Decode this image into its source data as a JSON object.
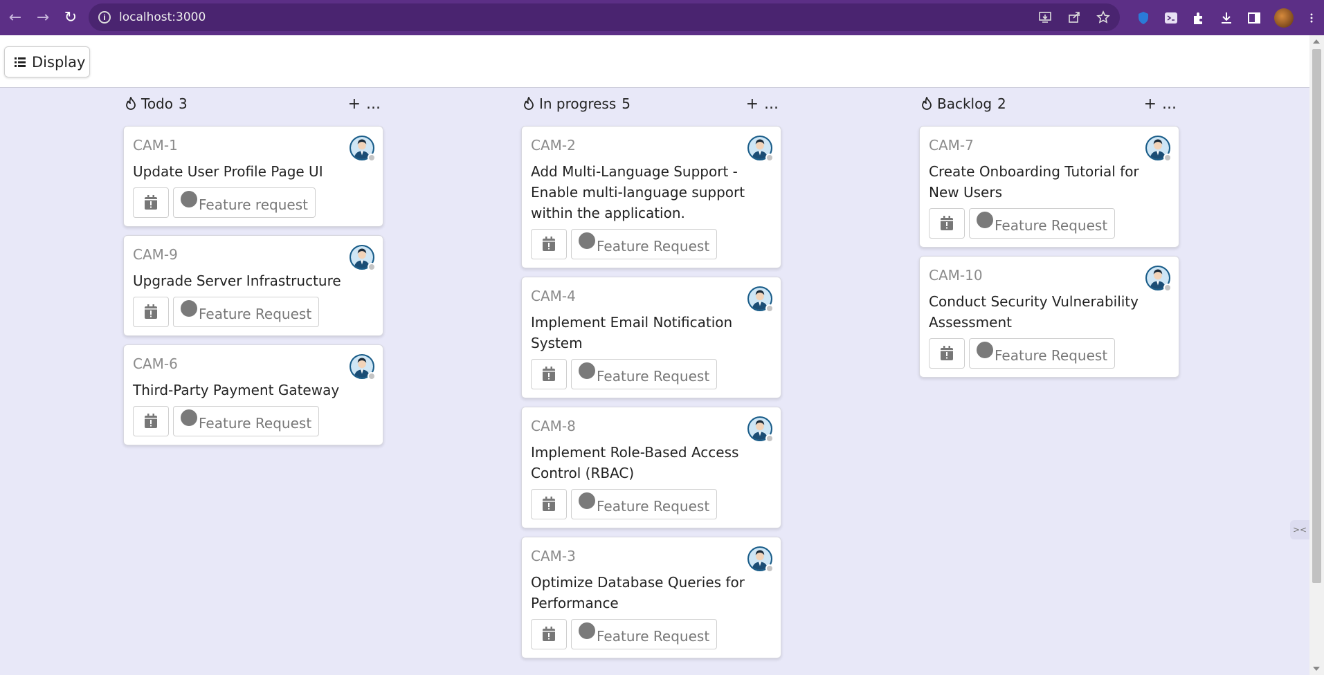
{
  "browser": {
    "url": "localhost:3000"
  },
  "toolbar": {
    "display_label": "Display"
  },
  "columns": [
    {
      "title": "Todo",
      "count": "3",
      "add_label": "+",
      "more_label": "...",
      "cards": [
        {
          "id": "CAM-1",
          "title": "Update User Profile Page UI",
          "tag": "Feature request"
        },
        {
          "id": "CAM-9",
          "title": "Upgrade Server Infrastructure",
          "tag": "Feature Request"
        },
        {
          "id": "CAM-6",
          "title": "Third-Party Payment Gateway",
          "tag": "Feature Request"
        }
      ]
    },
    {
      "title": "In progress",
      "count": "5",
      "add_label": "+",
      "more_label": "...",
      "cards": [
        {
          "id": "CAM-2",
          "title": "Add Multi-Language Support - Enable multi-language support within the application.",
          "tag": "Feature Request"
        },
        {
          "id": "CAM-4",
          "title": "Implement Email Notification System",
          "tag": "Feature Request"
        },
        {
          "id": "CAM-8",
          "title": "Implement Role-Based Access Control (RBAC)",
          "tag": "Feature Request"
        },
        {
          "id": "CAM-3",
          "title": "Optimize Database Queries for Performance",
          "tag": "Feature Request"
        }
      ]
    },
    {
      "title": "Backlog",
      "count": "2",
      "add_label": "+",
      "more_label": "...",
      "cards": [
        {
          "id": "CAM-7",
          "title": "Create Onboarding Tutorial for New Users",
          "tag": "Feature Request"
        },
        {
          "id": "CAM-10",
          "title": "Conduct Security Vulnerability Assessment",
          "tag": "Feature Request"
        }
      ]
    }
  ]
}
